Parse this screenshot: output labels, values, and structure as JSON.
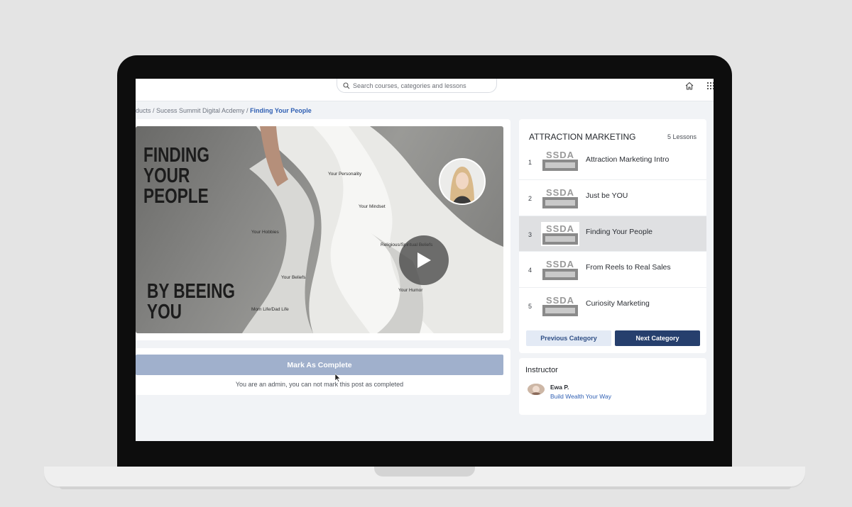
{
  "header": {
    "search_placeholder": "Search courses, categories and lessons"
  },
  "breadcrumb": {
    "prefix": "ducts / Sucess Summit Digital Acdemy / ",
    "current": "Finding Your People"
  },
  "video": {
    "title_top": "FINDING\nYOUR\nPEOPLE",
    "title_bottom": "BY BEEING\nYOU",
    "labels": [
      "Your Personality",
      "Your Mindset",
      "Your Hobbies",
      "Religious/Spiritual Beliefs",
      "Your Beliefs",
      "Your Humor",
      "Mom Life/Dad Life"
    ]
  },
  "completion": {
    "button_label": "Mark As Complete",
    "note": "You are an admin, you can not mark this post as completed"
  },
  "category": {
    "title": "ATTRACTION MARKETING",
    "count": "5 Lessons",
    "lessons": [
      {
        "number": "1",
        "name": "Attraction Marketing Intro",
        "thumb_text": "SSDA"
      },
      {
        "number": "2",
        "name": "Just be YOU",
        "thumb_text": "SSDA"
      },
      {
        "number": "3",
        "name": "Finding Your People",
        "thumb_text": "SSDA"
      },
      {
        "number": "4",
        "name": "From Reels to Real Sales",
        "thumb_text": "SSDA"
      },
      {
        "number": "5",
        "name": "Curiosity Marketing",
        "thumb_text": "SSDA"
      }
    ],
    "active_index": 2,
    "prev_label": "Previous Category",
    "next_label": "Next Category"
  },
  "instructor": {
    "heading": "Instructor",
    "name": "Ewa P.",
    "link": "Build Wealth Your Way"
  },
  "colors": {
    "accent": "#2f5fb3",
    "next_button": "#263f6d",
    "complete_button": "#a0b0cc"
  }
}
